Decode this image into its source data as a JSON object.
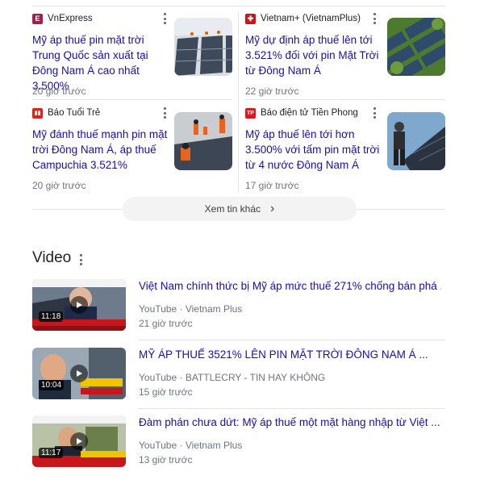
{
  "news": [
    {
      "source": "VnExpress",
      "headline": "Mỹ áp thuế pin mặt trời Trung Quốc sản xuất tại Đông Nam Á cao nhất 3.500%",
      "age": "20 giờ trước",
      "fav_color": "#9f224e",
      "fav_glyph": "E"
    },
    {
      "source": "Vietnam+ (VietnamPlus)",
      "headline": "Mỹ dự định áp thuế lên tới 3.521% đối với pin Mặt Trời từ Đông Nam Á",
      "age": "22 giờ trước",
      "fav_color": "#c4161c",
      "fav_glyph": "✚"
    },
    {
      "source": "Báo Tuổi Trẻ",
      "headline": "Mỹ đánh thuế mạnh pin mặt trời Đông Nam Á, áp thuế Campuchia 3.521%",
      "age": "20 giờ trước",
      "fav_color": "#d7261e",
      "fav_glyph": "▮▮"
    },
    {
      "source": "Báo điện tử Tiền Phong",
      "headline": "Mỹ áp thuế lên tới hơn 3.500% với tấm pin mặt trời từ 4 nước Đông Nam Á",
      "age": "17 giờ trước",
      "fav_color": "#d71920",
      "fav_glyph": "TP"
    }
  ],
  "more_button": {
    "label": "Xem tin khác",
    "chevron": "›"
  },
  "video_section": {
    "title": "Video"
  },
  "videos": [
    {
      "title": "Việt Nam chính thức bị Mỹ áp mức thuế 271% chống bán phá ...",
      "platform": "YouTube",
      "channel": "Vietnam Plus",
      "age": "21 giờ trước",
      "duration": "11:18"
    },
    {
      "title": "MỸ ÁP THUẾ 3521% LÊN PIN MẶT TRỜI ĐÔNG NAM Á ...",
      "platform": "YouTube",
      "channel": "BATTLECRY - TIN HAY KHÔNG",
      "age": "15 giờ trước",
      "duration": "10:04"
    },
    {
      "title": "Đàm phán chưa dứt: Mỹ áp thuế một mặt hàng nhập từ Việt ...",
      "platform": "YouTube",
      "channel": "Vietnam Plus",
      "age": "13 giờ trước",
      "duration": "11:17"
    }
  ],
  "meta_separator": " · ",
  "colors": {
    "link": "#1a0dab",
    "muted": "#70757a",
    "divider": "#e3e3e3",
    "chip": "#f1f3f4"
  },
  "icons": {
    "menu": "kebab-menu-icon",
    "play": "play-icon",
    "chevron": "chevron-right-icon"
  }
}
